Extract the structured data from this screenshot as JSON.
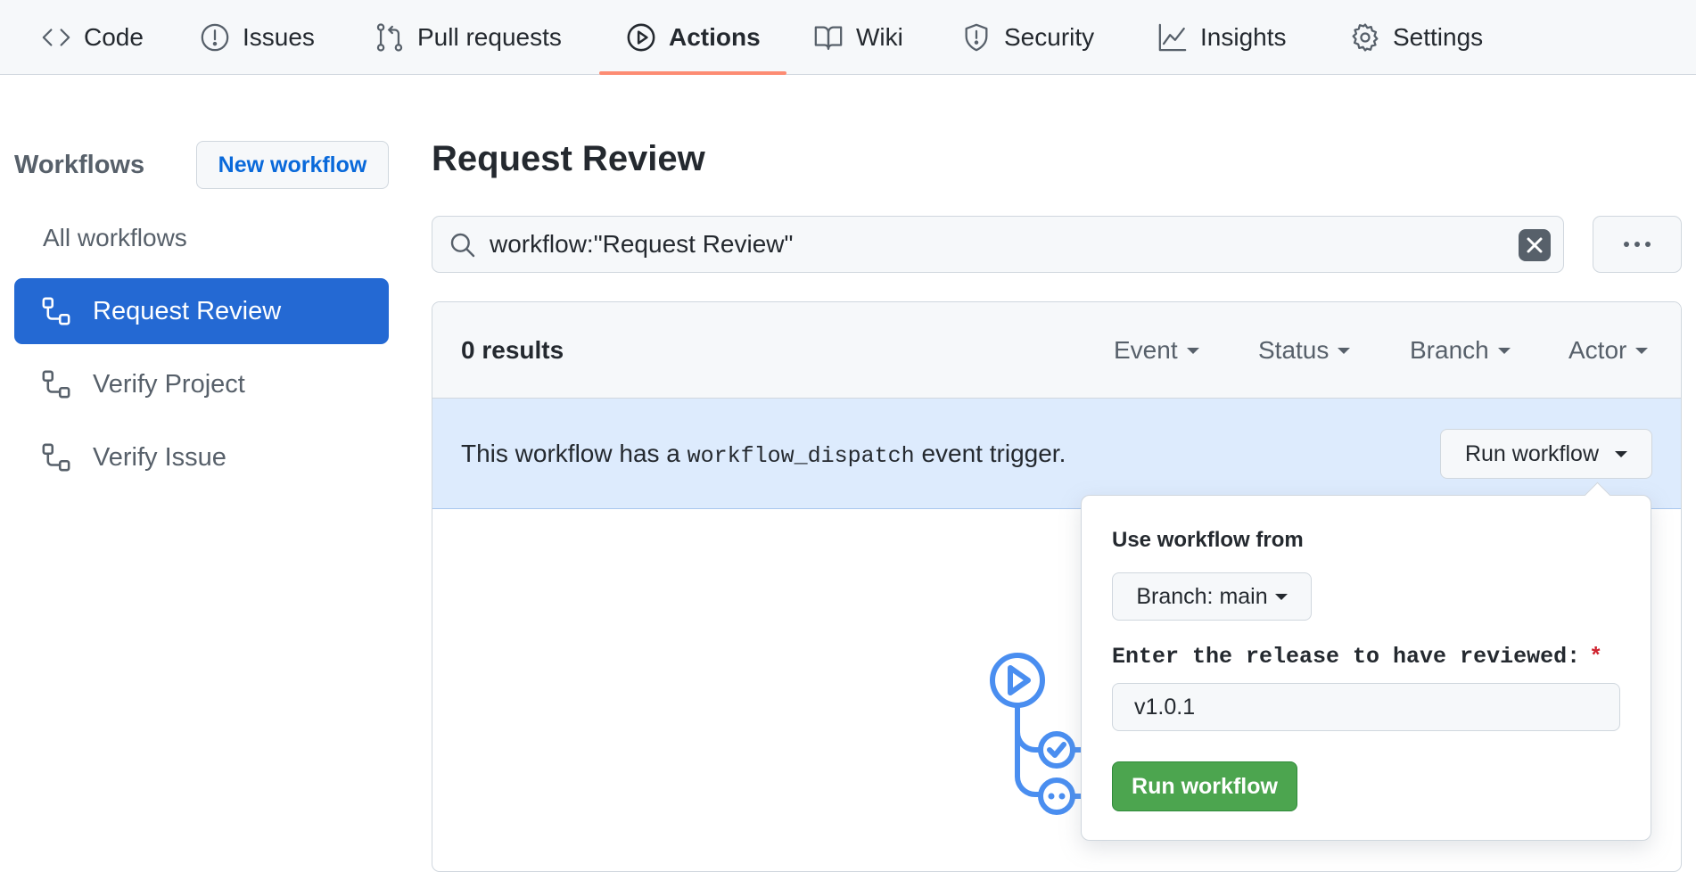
{
  "nav": {
    "tabs": [
      {
        "label": "Code",
        "icon": "code-icon"
      },
      {
        "label": "Issues",
        "icon": "issue-opened-icon"
      },
      {
        "label": "Pull requests",
        "icon": "git-pull-request-icon"
      },
      {
        "label": "Actions",
        "icon": "play-icon",
        "active": true
      },
      {
        "label": "Wiki",
        "icon": "book-icon"
      },
      {
        "label": "Security",
        "icon": "shield-icon"
      },
      {
        "label": "Insights",
        "icon": "graph-icon"
      },
      {
        "label": "Settings",
        "icon": "gear-icon"
      }
    ],
    "active_underline_color": "#fd8c73"
  },
  "sidebar": {
    "heading": "Workflows",
    "new_workflow_label": "New workflow",
    "all_workflows_label": "All workflows",
    "items": [
      {
        "label": "Request Review",
        "icon": "workflow-icon",
        "active": true
      },
      {
        "label": "Verify Project",
        "icon": "workflow-icon"
      },
      {
        "label": "Verify Issue",
        "icon": "workflow-icon"
      }
    ],
    "active_color": "#2469d3"
  },
  "main": {
    "title": "Request Review",
    "search": {
      "value": "workflow:\"Request Review\""
    },
    "results": {
      "count_label": "0 results",
      "filters": [
        "Event",
        "Status",
        "Branch",
        "Actor"
      ]
    },
    "banner": {
      "text_before": "This workflow has a ",
      "code": "workflow_dispatch",
      "text_after": " event trigger.",
      "run_button_label": "Run workflow",
      "background": "#ddebfd"
    }
  },
  "popover": {
    "use_from_label": "Use workflow from",
    "branch_label": "Branch: main",
    "input_label": "Enter the release to have reviewed:",
    "required_mark": "*",
    "input_value": "v1.0.1",
    "submit_label": "Run workflow",
    "submit_color": "#4ca54f"
  }
}
